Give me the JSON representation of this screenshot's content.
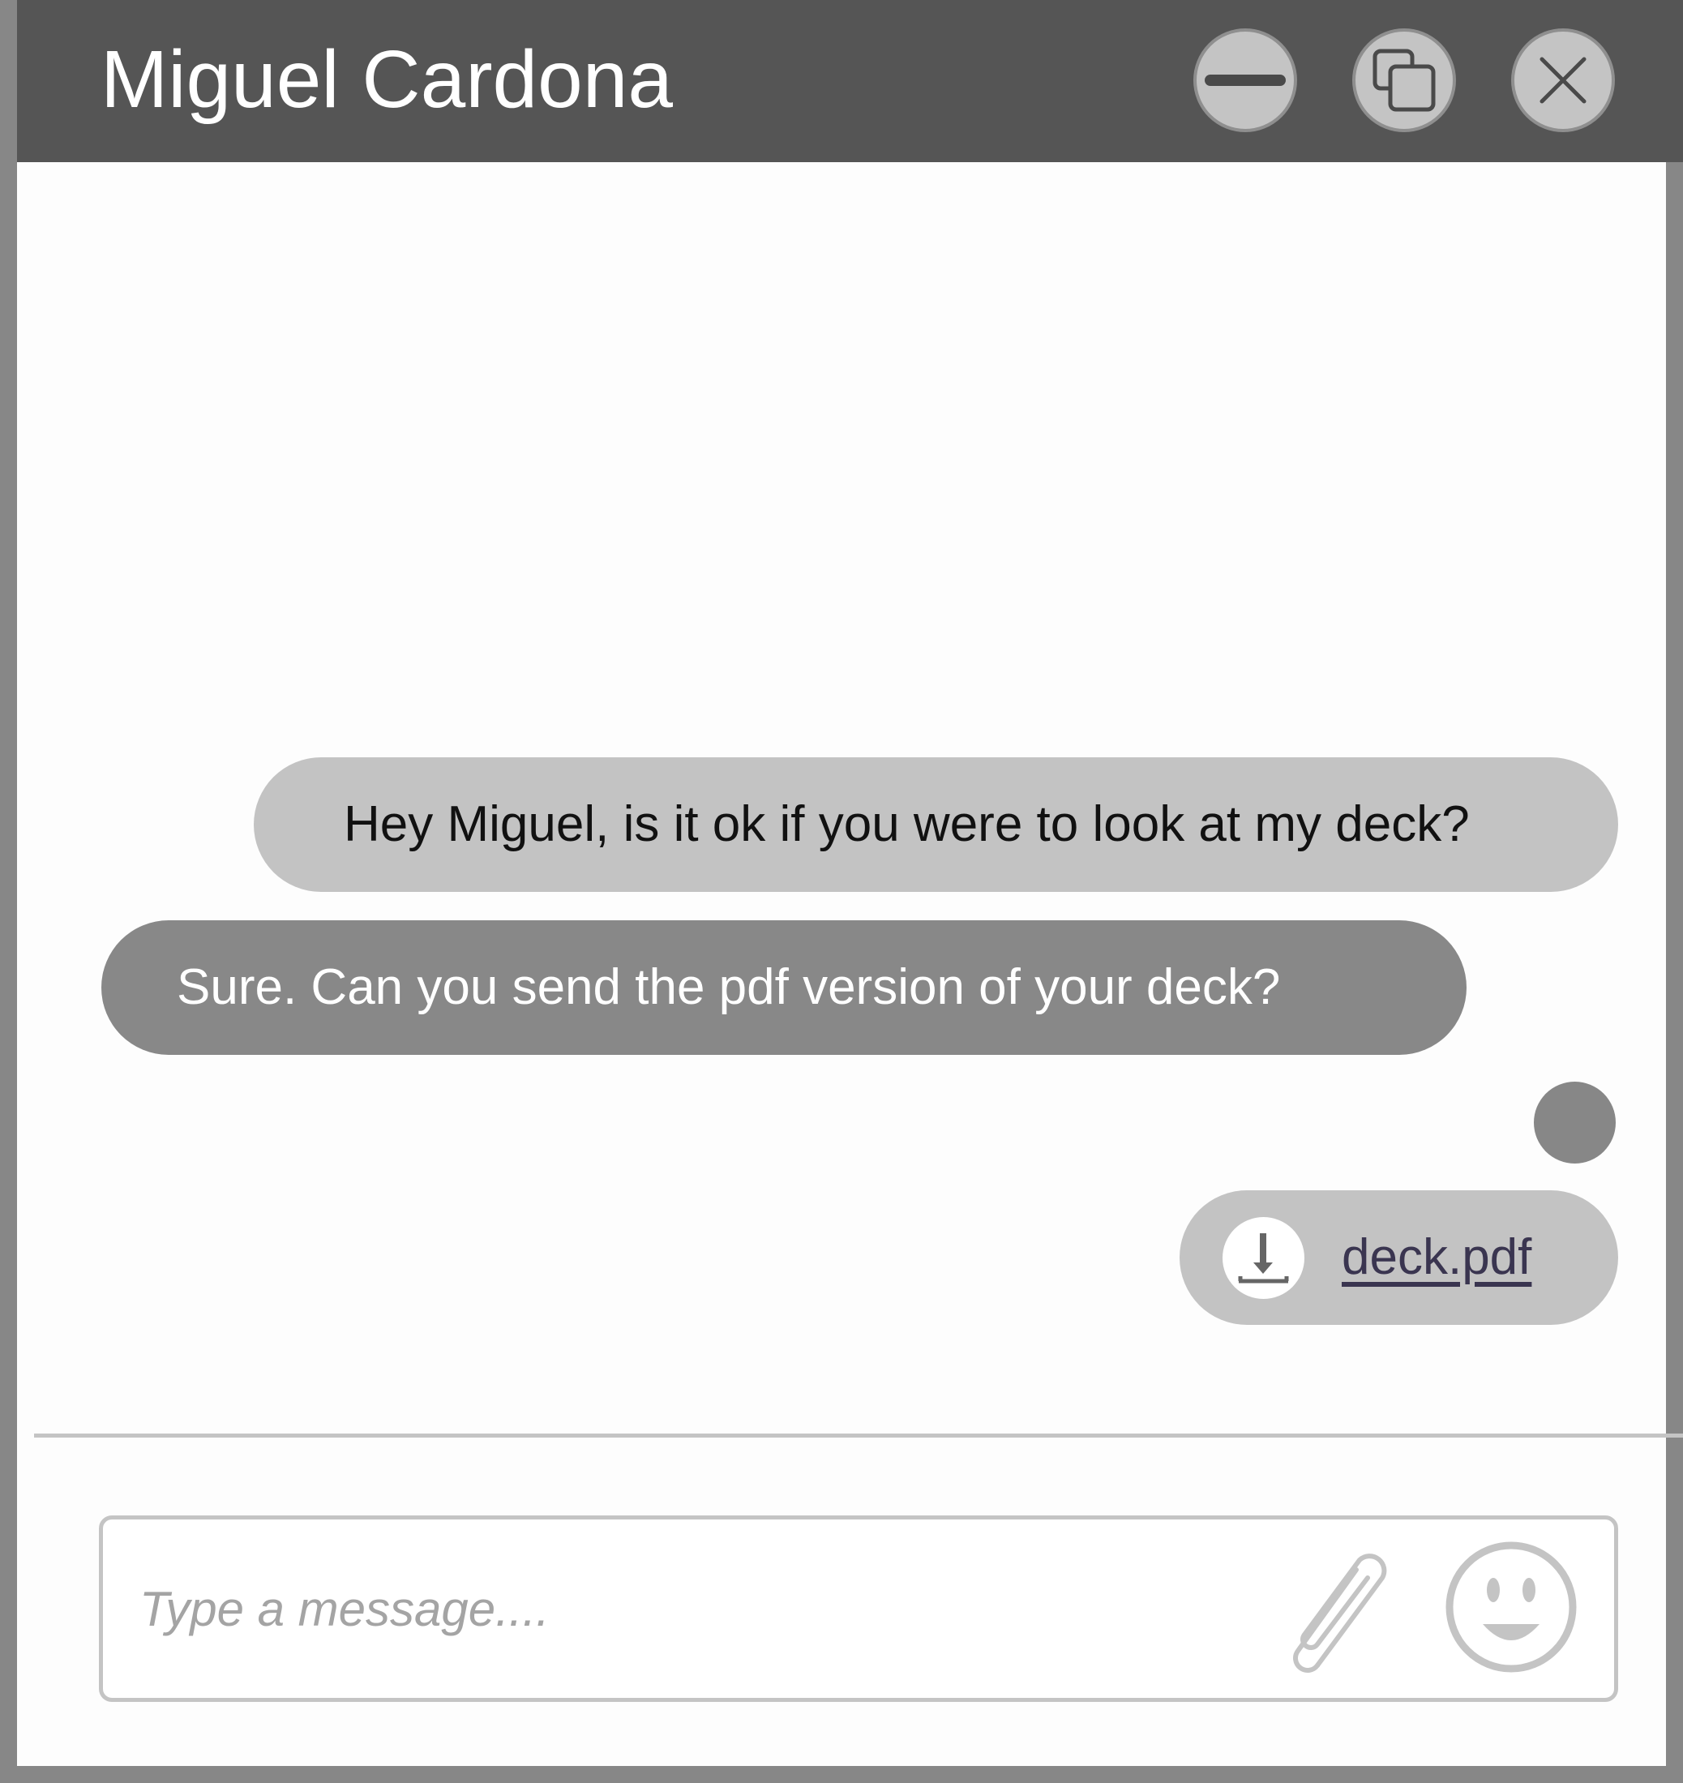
{
  "window": {
    "title": "Miguel Cardona",
    "controls": {
      "minimize_icon": "minimize-icon",
      "restore_icon": "restore-icon",
      "close_icon": "close-icon"
    }
  },
  "messages": [
    {
      "direction": "outgoing",
      "text": "Hey Miguel, is it ok if you were to look at my deck?"
    },
    {
      "direction": "incoming",
      "text": "Sure. Can you send the pdf version of your deck?"
    }
  ],
  "typing_indicator": {
    "icon": "typing-dot-icon"
  },
  "attachment": {
    "file_name": "deck.pdf",
    "icon": "download-icon"
  },
  "composer": {
    "placeholder": "Type a message....",
    "value": "",
    "attach_icon": "paperclip-icon",
    "emoji_icon": "smiley-icon"
  },
  "colors": {
    "titlebar": "#555555",
    "frame": "#878787",
    "outgoing_bubble": "#c3c3c3",
    "incoming_bubble": "#888888",
    "link": "#3a3550"
  }
}
